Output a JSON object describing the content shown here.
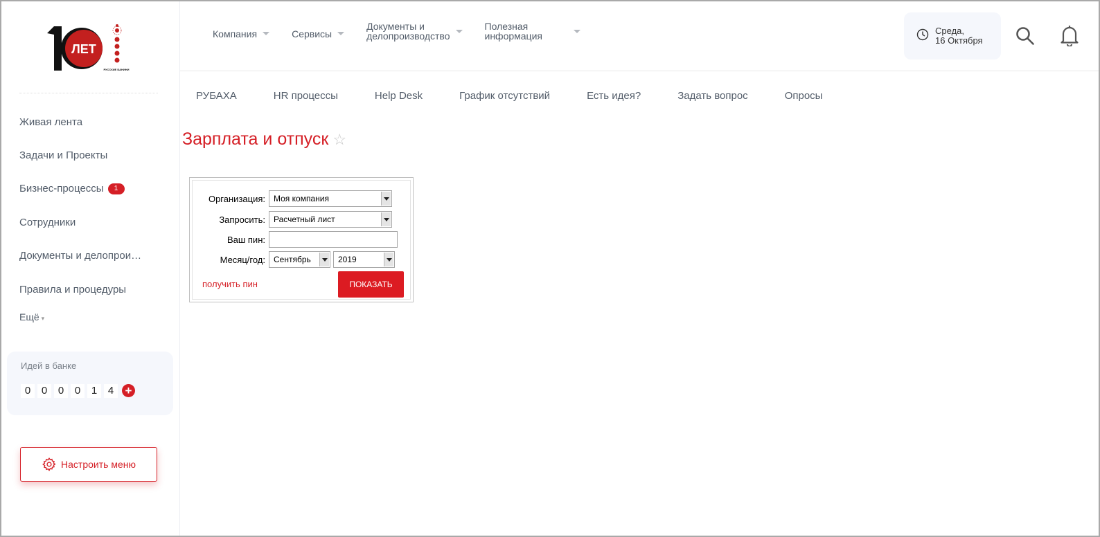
{
  "logo": {
    "number": "10",
    "text": "ЛЕТ",
    "caption": "РУССКИЕ БАНИНИ"
  },
  "sidebar": {
    "items": [
      {
        "label": "Живая лента"
      },
      {
        "label": "Задачи и Проекты"
      },
      {
        "label": "Бизнес-процессы",
        "badge": "1"
      },
      {
        "label": "Сотрудники"
      },
      {
        "label": "Документы и делопроизводство"
      },
      {
        "label": "Правила и процедуры"
      }
    ],
    "more_label": "Ещё",
    "ideas_title": "Идей в банке",
    "ideas_digits": [
      "0",
      "0",
      "0",
      "0",
      "1",
      "4"
    ],
    "ideas_add": "+",
    "configure_label": "Настроить меню"
  },
  "header": {
    "nav": [
      {
        "line1": "Компания",
        "line2": ""
      },
      {
        "line1": "Сервисы",
        "line2": ""
      },
      {
        "line1": "Документы и",
        "line2": "делопроизводство"
      },
      {
        "line1": "Полезная",
        "line2": "информация"
      }
    ],
    "date_line1": "Среда,",
    "date_line2": "16 Октября"
  },
  "subnav": [
    "РУБАХА",
    "HR процессы",
    "Help Desk",
    "График отсутствий",
    "Есть идея?",
    "Задать вопрос",
    "Опросы"
  ],
  "page": {
    "title": "Зарплата и отпуск",
    "star": "☆"
  },
  "form": {
    "org_label": "Организация:",
    "org_value": "Моя компания",
    "request_label": "Запросить:",
    "request_value": "Расчетный лист",
    "pin_label": "Ваш пин:",
    "pin_value": "",
    "period_label": "Месяц/год:",
    "month_value": "Сентябрь",
    "year_value": "2019",
    "get_pin_label": "получить пин",
    "show_label": "ПОКАЗАТЬ"
  },
  "colors": {
    "accent": "#d51f26",
    "menu_text": "#525c69",
    "panel_bg": "#f5f7fc"
  }
}
